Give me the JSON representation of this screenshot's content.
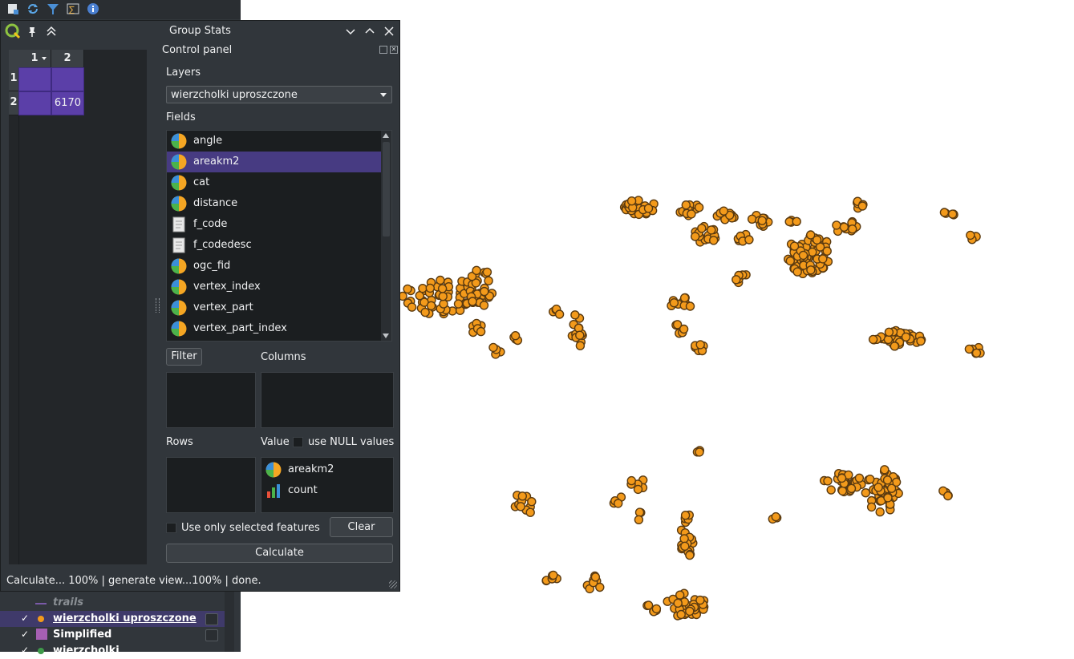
{
  "dialog": {
    "title": "Group Stats",
    "control_panel_label": "Control panel",
    "layers_label": "Layers",
    "layer_selected": "wierzcholki uproszczone",
    "fields_label": "Fields",
    "fields": [
      {
        "name": "angle",
        "icon": "numeric-field-icon",
        "selected": false
      },
      {
        "name": "areakm2",
        "icon": "numeric-field-icon",
        "selected": true
      },
      {
        "name": "cat",
        "icon": "numeric-field-icon",
        "selected": false
      },
      {
        "name": "distance",
        "icon": "numeric-field-icon",
        "selected": false
      },
      {
        "name": "f_code",
        "icon": "text-field-icon",
        "selected": false
      },
      {
        "name": "f_codedesc",
        "icon": "text-field-icon",
        "selected": false
      },
      {
        "name": "ogc_fid",
        "icon": "numeric-field-icon",
        "selected": false
      },
      {
        "name": "vertex_index",
        "icon": "numeric-field-icon",
        "selected": false
      },
      {
        "name": "vertex_part",
        "icon": "numeric-field-icon",
        "selected": false
      },
      {
        "name": "vertex_part_index",
        "icon": "numeric-field-icon",
        "selected": false
      }
    ],
    "filter_button": "Filter",
    "columns_label": "Columns",
    "rows_label": "Rows",
    "value_label": "Value",
    "null_values_label": "use NULL values",
    "value_items": [
      {
        "name": "areakm2",
        "icon": "numeric-field-icon"
      },
      {
        "name": "count",
        "icon": "count-function-icon"
      }
    ],
    "selected_only_label": "Use only selected features",
    "clear_button": "Clear",
    "calculate_button": "Calculate",
    "status": "Calculate... 100% |  generate view...100% |  done."
  },
  "table": {
    "col_headers": [
      "1",
      "2"
    ],
    "row_headers": [
      "1",
      "2"
    ],
    "cells": [
      [
        "",
        ""
      ],
      [
        "",
        "6170"
      ]
    ]
  },
  "layers_panel": {
    "items": [
      {
        "label": "trails",
        "style": "italic-muted"
      },
      {
        "label": "wierzcholki uproszczone",
        "selected": true
      },
      {
        "label": "Simplified"
      },
      {
        "label": "wierzcholki"
      }
    ]
  },
  "colors": {
    "accent": "#5b3fa8",
    "selection": "#473b82",
    "point_fill": "#f39a1b",
    "point_stroke": "#5a3a10"
  }
}
